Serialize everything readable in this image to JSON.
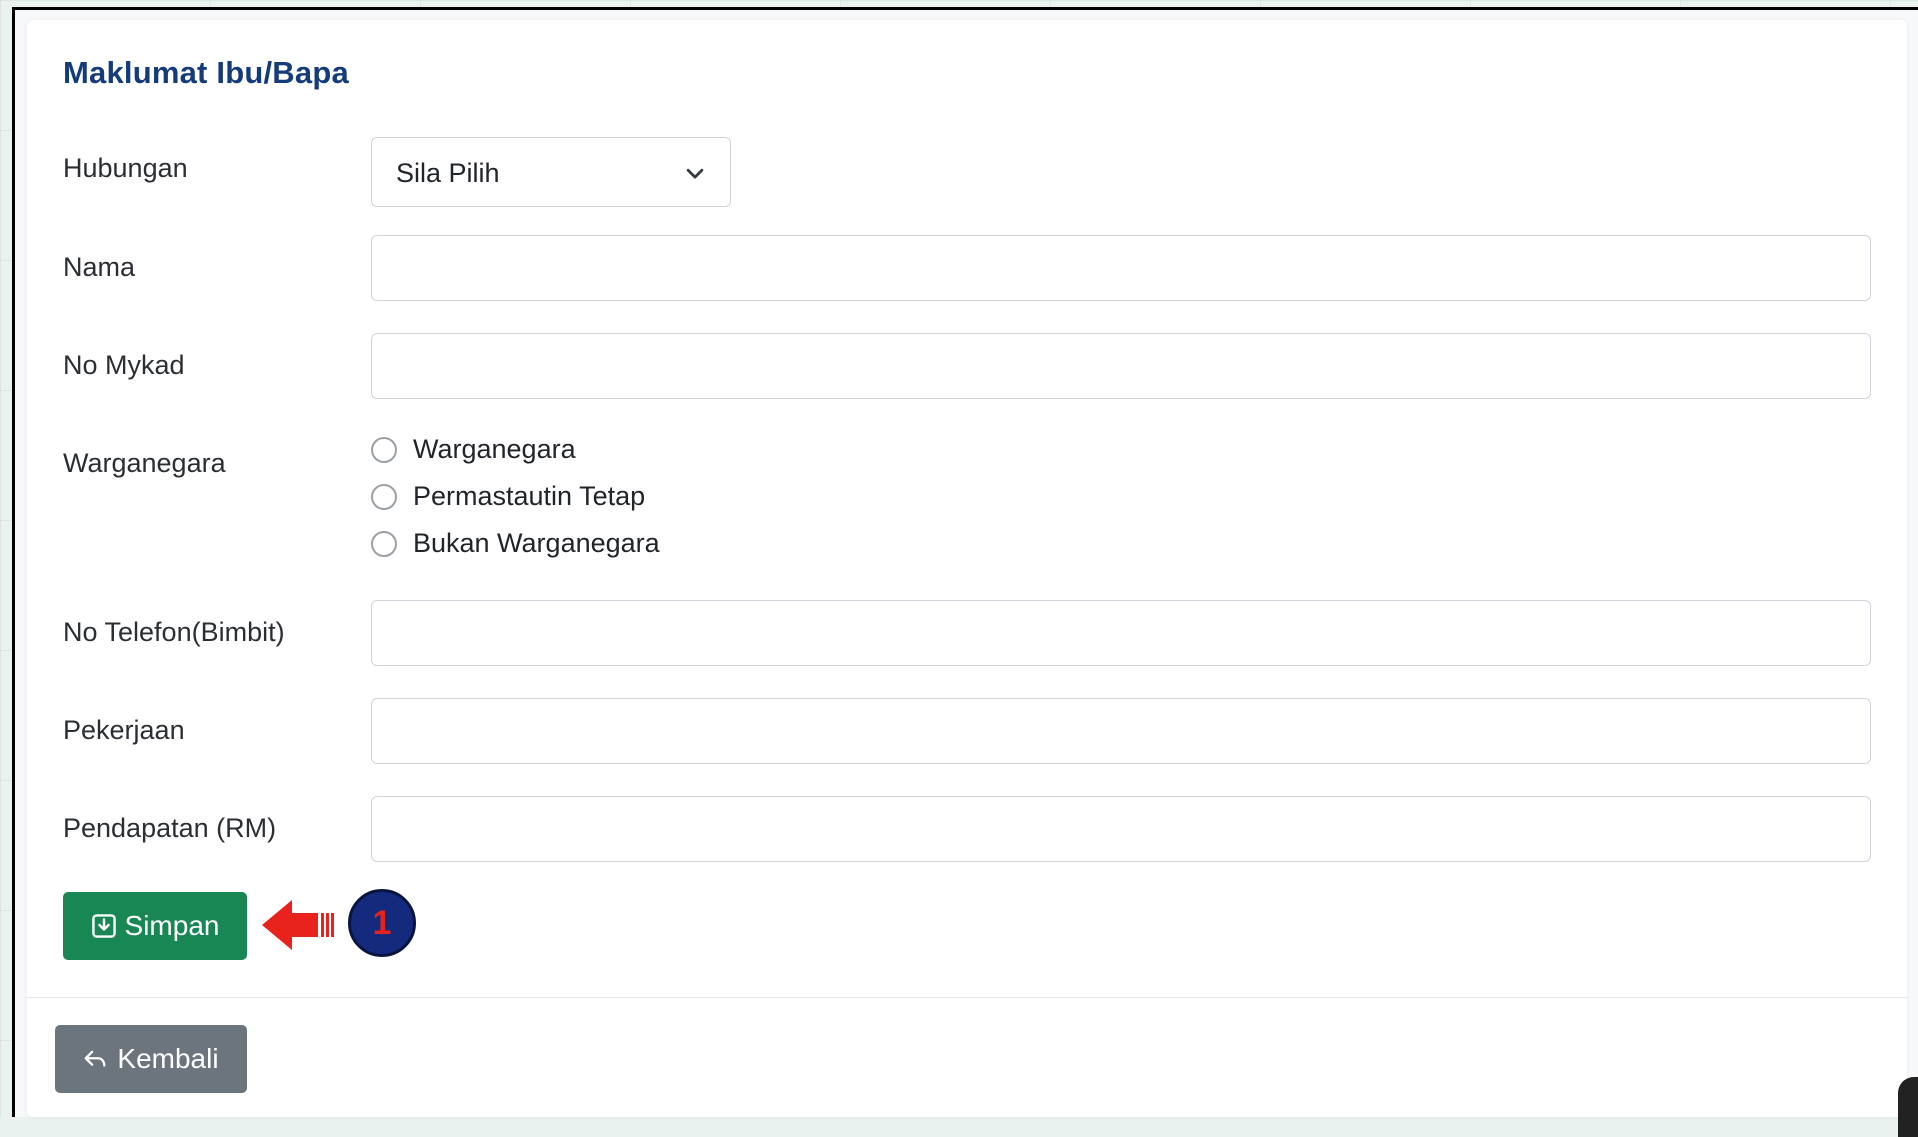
{
  "section": {
    "title": "Maklumat Ibu/Bapa"
  },
  "form": {
    "hubungan": {
      "label": "Hubungan",
      "selected": "Sila Pilih"
    },
    "nama": {
      "label": "Nama",
      "value": ""
    },
    "no_mykad": {
      "label": "No Mykad",
      "value": ""
    },
    "warganegara": {
      "label": "Warganegara",
      "options": [
        "Warganegara",
        "Permastautin Tetap",
        "Bukan Warganegara"
      ]
    },
    "no_telefon": {
      "label": "No Telefon(Bimbit)",
      "value": ""
    },
    "pekerjaan": {
      "label": "Pekerjaan",
      "value": ""
    },
    "pendapatan": {
      "label": "Pendapatan (RM)",
      "value": ""
    }
  },
  "buttons": {
    "save_label": "Simpan",
    "back_label": "Kembali"
  },
  "annotation": {
    "step_number": "1",
    "arrow_color": "#e8231e",
    "badge_color": "#142a7c"
  },
  "colors": {
    "title": "#143c7a",
    "save_button": "#198754",
    "back_button": "#6c757d"
  },
  "icons": {
    "select": "chevron-down-icon",
    "save": "save-icon",
    "back": "reply-arrow-icon"
  }
}
